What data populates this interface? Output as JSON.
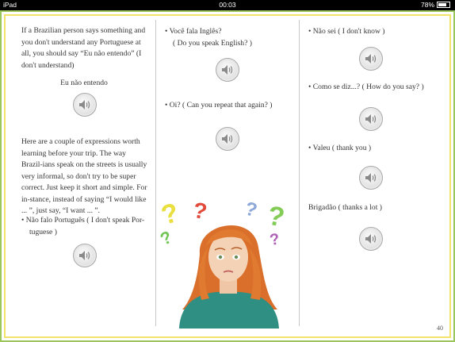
{
  "status_bar": {
    "device": "iPad",
    "time": "00:03",
    "battery": "78%"
  },
  "column1": {
    "intro": "If a Brazilian person says something and you don't understand any Portuguese at all, you should say “Eu não entendo” (I don't understand)",
    "phrase_label": "Eu não entendo",
    "tips": "Here are a couple of expressions worth learning before your trip. The way Brazil-ians speak on the streets is usually very informal, so don't try to be super correct. Just keep it short and simple. For in-stance, instead of saying “I would like ... ”, just say, “I want ... ”.",
    "item1_line1": "•  Não falo Português ( I don't speak Por-",
    "item1_line2": "tuguese )"
  },
  "column2": {
    "item1_line1": "•  Você fala Inglês?",
    "item1_line2": "( Do you speak English? )",
    "item2": "•  Oi? ( Can you repeat that again? )"
  },
  "column3": {
    "item1": "•  Não sei ( I don't know )",
    "item2": "•  Como se diz...? ( How do you say? )",
    "item3": "•  Valeu ( thank you )",
    "item4": "Brigadão ( thanks a lot )"
  },
  "page_number": "40",
  "icons": {
    "audio": "speaker-icon"
  },
  "colors": {
    "outer_border": "#9bc65c",
    "inner_border": "#f2e36a"
  }
}
